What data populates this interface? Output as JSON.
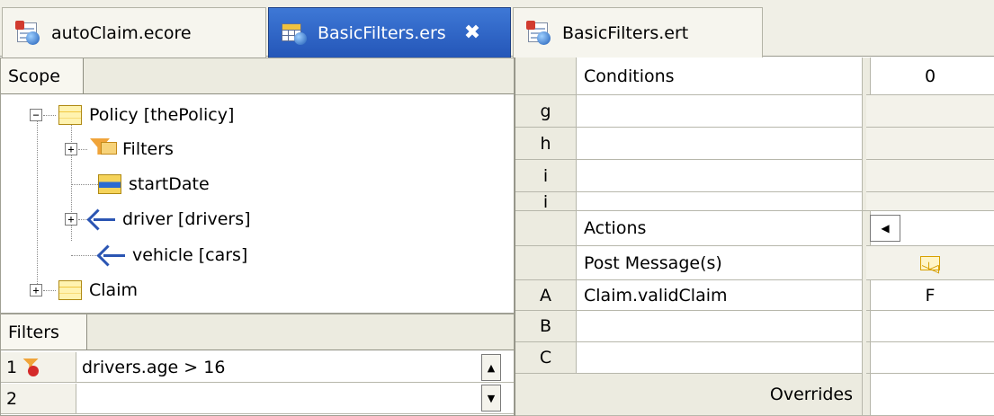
{
  "tabs": [
    {
      "label": "autoClaim.ecore",
      "icon": "ecore-file-icon",
      "active": false
    },
    {
      "label": "BasicFilters.ers",
      "icon": "rulesheet-file-icon",
      "active": true,
      "close": "✖"
    },
    {
      "label": "BasicFilters.ert",
      "icon": "ruletest-file-icon",
      "active": false
    }
  ],
  "scope": {
    "tab_label": "Scope",
    "tree": {
      "policy": "Policy [thePolicy]",
      "filters": "Filters",
      "start_date": "startDate",
      "driver": "driver [drivers]",
      "vehicle": "vehicle [cars]",
      "claim": "Claim"
    },
    "expander_plus": "+",
    "expander_minus": "−"
  },
  "filters": {
    "tab_label": "Filters",
    "rows": [
      {
        "num": "1",
        "expr": "drivers.age > 16"
      },
      {
        "num": "2",
        "expr": ""
      }
    ],
    "scroll_up": "▲",
    "scroll_down": "▼"
  },
  "grid": {
    "conditions_header": "Conditions",
    "column_0": "0",
    "condition_rows": [
      "g",
      "h",
      "i",
      "i"
    ],
    "actions_header": "Actions",
    "post_message": "Post Message(s)",
    "action_rows": [
      {
        "id": "A",
        "text": "Claim.validClaim",
        "val": "F"
      },
      {
        "id": "B",
        "text": "",
        "val": ""
      },
      {
        "id": "C",
        "text": "",
        "val": ""
      }
    ],
    "overrides": "Overrides",
    "scroll_left": "◀"
  }
}
